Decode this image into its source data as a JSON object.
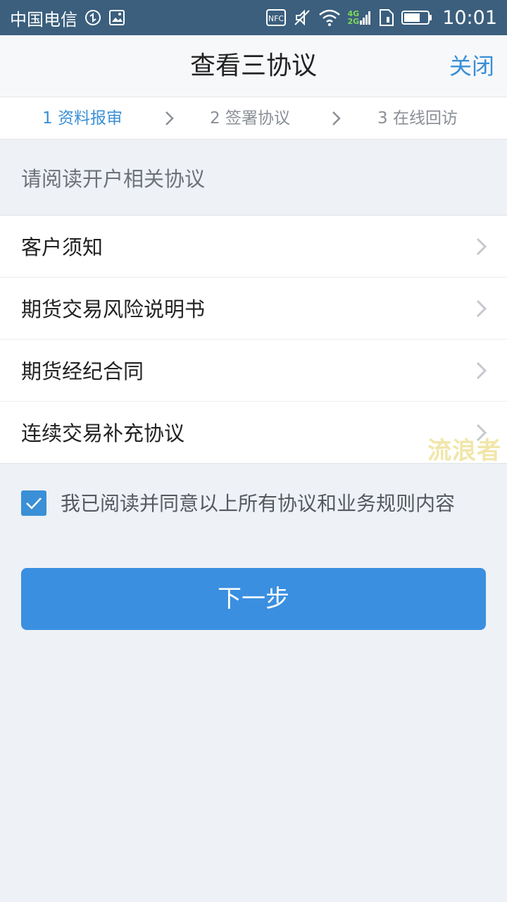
{
  "status_bar": {
    "carrier": "中国电信",
    "nfc": "NFC",
    "network_top": "4G",
    "network_bottom": "2G",
    "time": "10:01"
  },
  "header": {
    "title": "查看三协议",
    "close_label": "关闭"
  },
  "steps": [
    {
      "label": "1 资料报审",
      "active": true
    },
    {
      "label": "2 签署协议",
      "active": false
    },
    {
      "label": "3 在线回访",
      "active": false
    }
  ],
  "section": {
    "title": "请阅读开户相关协议"
  },
  "agreements": [
    {
      "label": "客户须知"
    },
    {
      "label": "期货交易风险说明书"
    },
    {
      "label": "期货经纪合同"
    },
    {
      "label": "连续交易补充协议"
    }
  ],
  "watermark": "流浪者",
  "consent": {
    "checked": true,
    "text": "我已阅读并同意以上所有协议和业务规则内容"
  },
  "next_button": {
    "label": "下一步"
  },
  "colors": {
    "accent": "#3a8fd6",
    "status_bar": "#3b5f7d",
    "button": "#3a8fe0"
  }
}
